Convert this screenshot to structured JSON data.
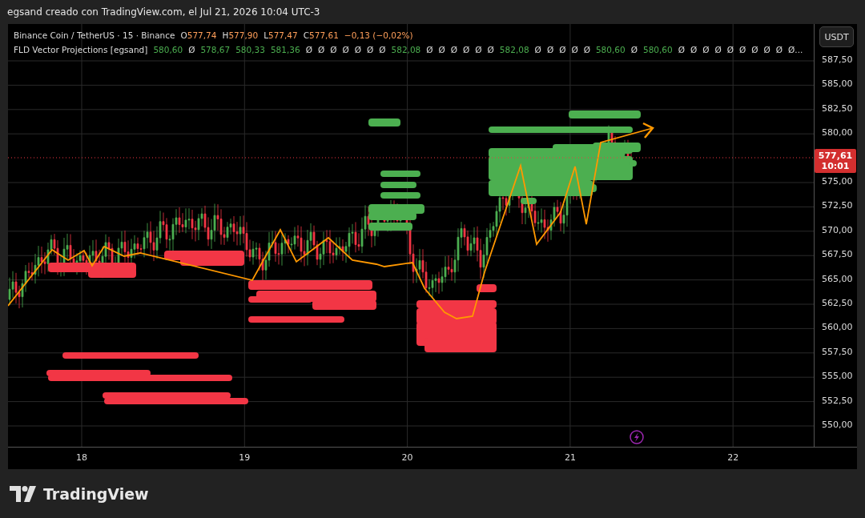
{
  "snapshot_caption": "egsand creado con TradingView.com, el Jul 21, 2026 10:04 UTC-3",
  "legend": {
    "symbol": "Binance Coin / TetherUS · 15 · Binance",
    "ohlc": [
      {
        "label": "O",
        "value": "577,74"
      },
      {
        "label": "H",
        "value": "577,90"
      },
      {
        "label": "L",
        "value": "577,47"
      },
      {
        "label": "C",
        "value": "577,61"
      }
    ],
    "change": "−0,13 (−0,02%)",
    "indicator": "FLD Vector Projections [egsand]",
    "indicator_values": [
      {
        "kind": "number",
        "text": "580,60"
      },
      {
        "kind": "empty",
        "text": "Ø"
      },
      {
        "kind": "number",
        "text": "578,67"
      },
      {
        "kind": "number",
        "text": "580,33"
      },
      {
        "kind": "number",
        "text": "581,36"
      },
      {
        "kind": "empty",
        "text": "Ø"
      },
      {
        "kind": "empty",
        "text": "Ø"
      },
      {
        "kind": "empty",
        "text": "Ø"
      },
      {
        "kind": "empty",
        "text": "Ø"
      },
      {
        "kind": "empty",
        "text": "Ø"
      },
      {
        "kind": "empty",
        "text": "Ø"
      },
      {
        "kind": "empty",
        "text": "Ø"
      },
      {
        "kind": "number",
        "text": "582,08"
      },
      {
        "kind": "empty",
        "text": "Ø"
      },
      {
        "kind": "empty",
        "text": "Ø"
      },
      {
        "kind": "empty",
        "text": "Ø"
      },
      {
        "kind": "empty",
        "text": "Ø"
      },
      {
        "kind": "empty",
        "text": "Ø"
      },
      {
        "kind": "empty",
        "text": "Ø"
      },
      {
        "kind": "number",
        "text": "582,08"
      },
      {
        "kind": "empty",
        "text": "Ø"
      },
      {
        "kind": "empty",
        "text": "Ø"
      },
      {
        "kind": "empty",
        "text": "Ø"
      },
      {
        "kind": "empty",
        "text": "Ø"
      },
      {
        "kind": "empty",
        "text": "Ø"
      },
      {
        "kind": "number",
        "text": "580,60"
      },
      {
        "kind": "empty",
        "text": "Ø"
      },
      {
        "kind": "number",
        "text": "580,60"
      },
      {
        "kind": "empty",
        "text": "Ø"
      },
      {
        "kind": "empty",
        "text": "Ø"
      },
      {
        "kind": "empty",
        "text": "Ø"
      },
      {
        "kind": "empty",
        "text": "Ø"
      },
      {
        "kind": "empty",
        "text": "Ø"
      },
      {
        "kind": "empty",
        "text": "Ø"
      },
      {
        "kind": "empty",
        "text": "Ø"
      },
      {
        "kind": "empty",
        "text": "Ø"
      },
      {
        "kind": "empty",
        "text": "Ø"
      },
      {
        "kind": "empty",
        "text": "Ø..."
      }
    ]
  },
  "price_axis": {
    "currency": "USDT",
    "ticks": [
      "587,50",
      "585,00",
      "582,50",
      "580,00",
      "575,00",
      "572,50",
      "570,00",
      "567,50",
      "565,00",
      "562,50",
      "560,00",
      "557,50",
      "555,00",
      "552,50",
      "550,00"
    ],
    "last_price": "577,61",
    "countdown": "10:01"
  },
  "time_axis": {
    "ticks": [
      "18",
      "19",
      "20",
      "21",
      "22"
    ]
  },
  "footer": {
    "brand": "TradingView"
  }
}
